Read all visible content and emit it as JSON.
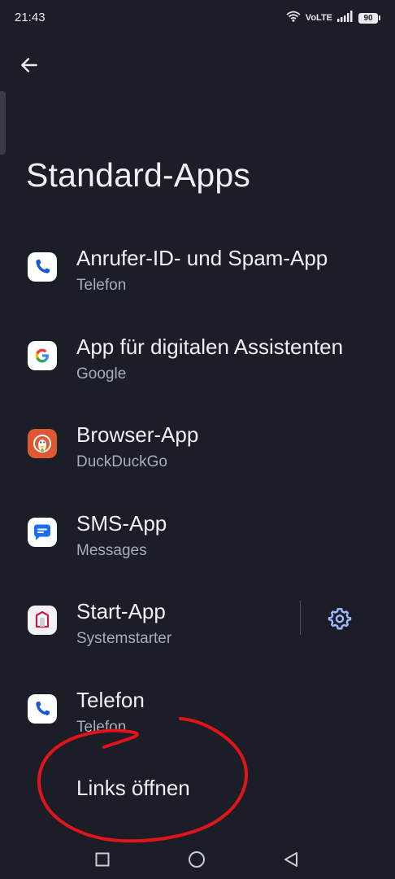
{
  "status_bar": {
    "time": "21:43",
    "network_label": "VoLTE",
    "battery_level": "90"
  },
  "header": {
    "title": "Standard-Apps"
  },
  "items": [
    {
      "title": "Anrufer-ID- und Spam-App",
      "subtitle": "Telefon",
      "icon": "phone-app-icon"
    },
    {
      "title": "App für digitalen Assistenten",
      "subtitle": "Google",
      "icon": "google-icon"
    },
    {
      "title": "Browser-App",
      "subtitle": "DuckDuckGo",
      "icon": "duckduckgo-icon"
    },
    {
      "title": "SMS-App",
      "subtitle": "Messages",
      "icon": "messages-icon"
    },
    {
      "title": "Start-App",
      "subtitle": "Systemstarter",
      "icon": "system-launcher-icon"
    },
    {
      "title": "Telefon",
      "subtitle": "Telefon",
      "icon": "phone-app-icon"
    }
  ],
  "links": {
    "label": "Links öffnen"
  },
  "colors": {
    "background": "#1b1e26",
    "annotation": "#e0141a"
  }
}
